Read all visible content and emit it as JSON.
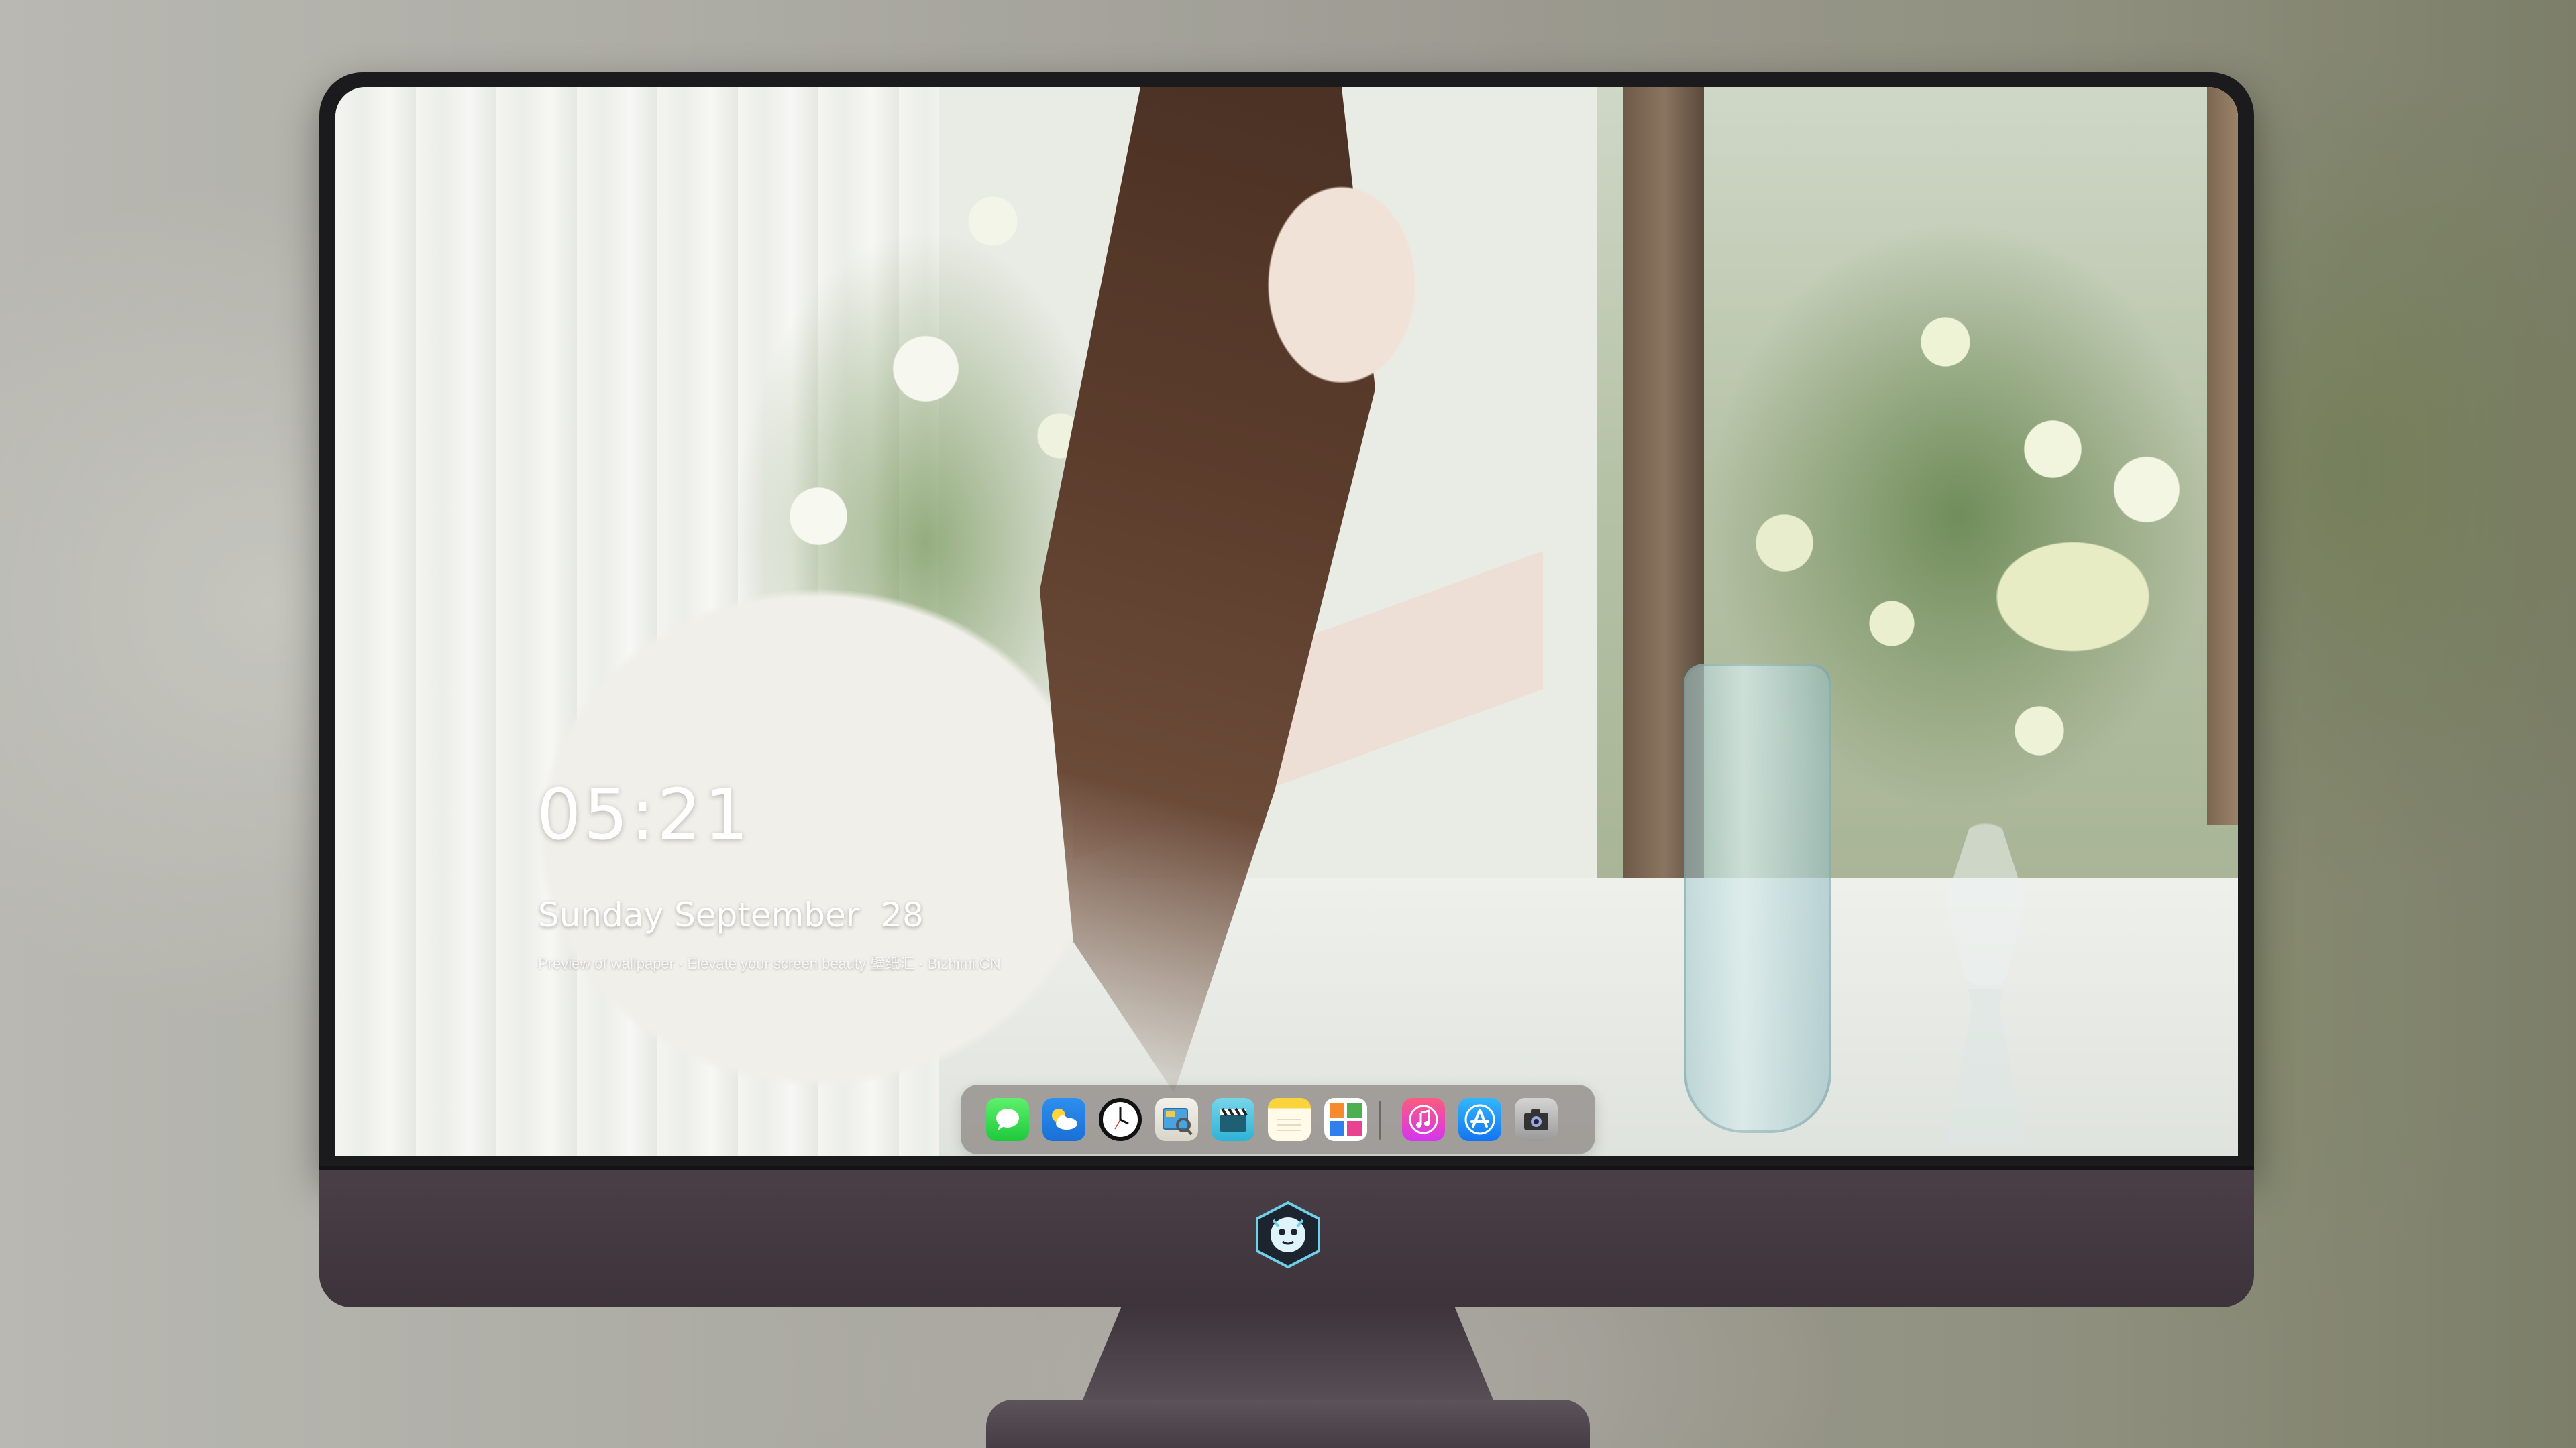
{
  "lockscreen": {
    "time": "05:21",
    "date": "Sunday September  28",
    "tagline": "Preview of wallpaper · Elevate your screen beauty  壁纸汇 · Bizhimi.CN"
  },
  "dock": {
    "apps": [
      {
        "name": "Messages",
        "icon": "messages-icon"
      },
      {
        "name": "Weather",
        "icon": "weather-icon"
      },
      {
        "name": "Clock",
        "icon": "clock-icon"
      },
      {
        "name": "Preview",
        "icon": "preview-icon"
      },
      {
        "name": "Clips",
        "icon": "clapperboard-icon"
      },
      {
        "name": "Notes",
        "icon": "notes-icon"
      },
      {
        "name": "Photo Booth",
        "icon": "photos-icon"
      },
      {
        "name": "Music",
        "icon": "music-icon"
      },
      {
        "name": "App Store",
        "icon": "app-store-icon"
      },
      {
        "name": "Camera",
        "icon": "camera-icon"
      }
    ]
  },
  "colors": {
    "monitor_bezel": "#1b1a1c",
    "monitor_chin": "#4a3f47",
    "dock_bg": "rgba(110,100,98,0.55)",
    "clock_text": "#ffffff"
  }
}
